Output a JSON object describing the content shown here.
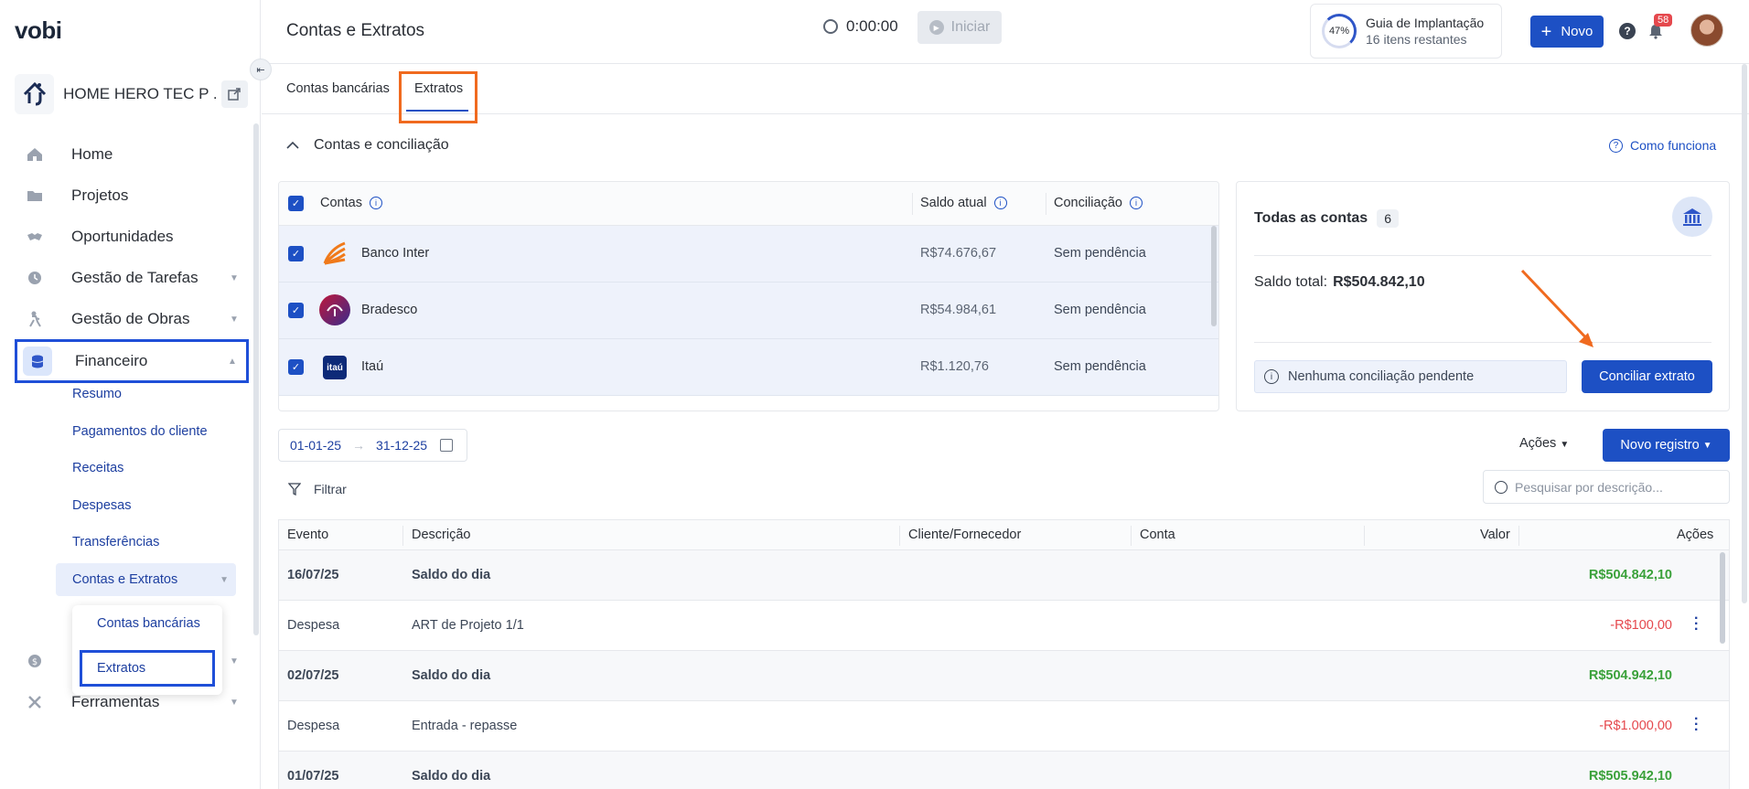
{
  "app": {
    "logo": "vobi",
    "page_title": "Contas e Extratos"
  },
  "sidebar": {
    "company_name": "HOME HERO TEC P ...",
    "items": [
      {
        "label": "Home"
      },
      {
        "label": "Projetos"
      },
      {
        "label": "Oportunidades"
      },
      {
        "label": "Gestão de Tarefas"
      },
      {
        "label": "Gestão de Obras"
      },
      {
        "label": "Financeiro"
      },
      {
        "label": "Ferramentas"
      }
    ],
    "financeiro_sub": [
      {
        "label": "Resumo"
      },
      {
        "label": "Pagamentos do cliente"
      },
      {
        "label": "Receitas"
      },
      {
        "label": "Despesas"
      },
      {
        "label": "Transferências"
      },
      {
        "label": "Contas e Extratos"
      }
    ],
    "flyout": [
      {
        "label": "Contas bancárias"
      },
      {
        "label": "Extratos"
      }
    ]
  },
  "header": {
    "timer": "0:00:00",
    "start_label": "Iniciar",
    "guide_percent": "47%",
    "guide_title": "Guia de Implantação",
    "guide_sub": "16 itens restantes",
    "new_label": "Novo",
    "help_glyph": "?",
    "notif_count": "58"
  },
  "tabs": [
    {
      "label": "Contas bancárias"
    },
    {
      "label": "Extratos"
    }
  ],
  "section": {
    "title": "Contas e conciliação",
    "how_it_works": "Como funciona",
    "accounts_header": {
      "contas": "Contas",
      "saldo": "Saldo atual",
      "conciliacao": "Conciliação"
    },
    "accounts": [
      {
        "name": "Banco Inter",
        "balance": "R$74.676,67",
        "status": "Sem pendência"
      },
      {
        "name": "Bradesco",
        "balance": "R$54.984,61",
        "status": "Sem pendência"
      },
      {
        "name": "Itaú",
        "balance": "R$1.120,76",
        "status": "Sem pendência"
      }
    ],
    "itau_logo_text": "itaú"
  },
  "summary": {
    "title": "Todas as contas",
    "count": "6",
    "total_label": "Saldo total:",
    "total_value": "R$504.842,10",
    "pending_text": "Nenhuma conciliação pendente",
    "reconcile_button": "Conciliar extrato"
  },
  "filters": {
    "date_from": "01-01-25",
    "date_to": "31-12-25",
    "actions_label": "Ações",
    "new_record_label": "Novo registro",
    "filter_label": "Filtrar",
    "search_placeholder": "Pesquisar por descrição..."
  },
  "table": {
    "headers": {
      "evento": "Evento",
      "descricao": "Descrição",
      "cliente": "Cliente/Fornecedor",
      "conta": "Conta",
      "valor": "Valor",
      "acoes": "Ações"
    },
    "rows": [
      {
        "evento": "16/07/25",
        "descricao": "Saldo do dia",
        "valor": "R$504.842,10",
        "type": "day"
      },
      {
        "evento": "Despesa",
        "descricao": "ART de Projeto 1/1",
        "valor": "-R$100,00",
        "type": "expense"
      },
      {
        "evento": "02/07/25",
        "descricao": "Saldo do dia",
        "valor": "R$504.942,10",
        "type": "day"
      },
      {
        "evento": "Despesa",
        "descricao": "Entrada - repasse",
        "valor": "-R$1.000,00",
        "type": "expense"
      },
      {
        "evento": "01/07/25",
        "descricao": "Saldo do dia",
        "valor": "R$505.942,10",
        "type": "day"
      }
    ]
  },
  "colors": {
    "primary": "#1d50c4",
    "positive": "#3aa13a",
    "negative": "#e5484d",
    "highlight_orange": "#f06a1f",
    "highlight_blue": "#1f4fd8"
  }
}
